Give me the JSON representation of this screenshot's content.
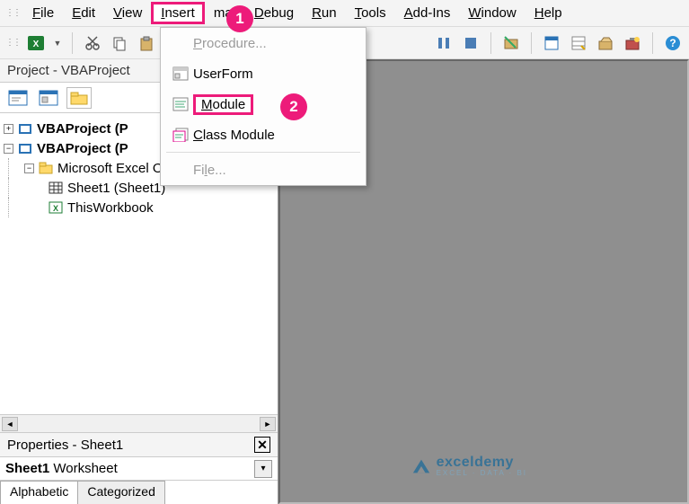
{
  "menu": {
    "file": "File",
    "edit": "Edit",
    "view": "View",
    "insert": "Insert",
    "format": "mat",
    "debug": "Debug",
    "run": "Run",
    "tools": "Tools",
    "addins": "Add-Ins",
    "window": "Window",
    "help": "Help"
  },
  "dropdown": {
    "procedure": "Procedure...",
    "userform": "UserForm",
    "module": "Module",
    "classmodule": "Class Module",
    "file": "File..."
  },
  "badges": {
    "one": "1",
    "two": "2"
  },
  "project_panel": {
    "title": "Project - VBAProject",
    "tree": {
      "proj1": "VBAProject (P",
      "proj2": "VBAProject (P",
      "excel_objects": "Microsoft Excel Objects",
      "sheet1": "Sheet1 (Sheet1)",
      "thisworkbook": "ThisWorkbook"
    }
  },
  "properties": {
    "title": "Properties - Sheet1",
    "combo_bold": "Sheet1",
    "combo_rest": " Worksheet",
    "tab_alpha": "Alphabetic",
    "tab_cat": "Categorized"
  },
  "watermark": {
    "brand": "exceldemy",
    "sub": "EXCEL · DATA · BI"
  }
}
